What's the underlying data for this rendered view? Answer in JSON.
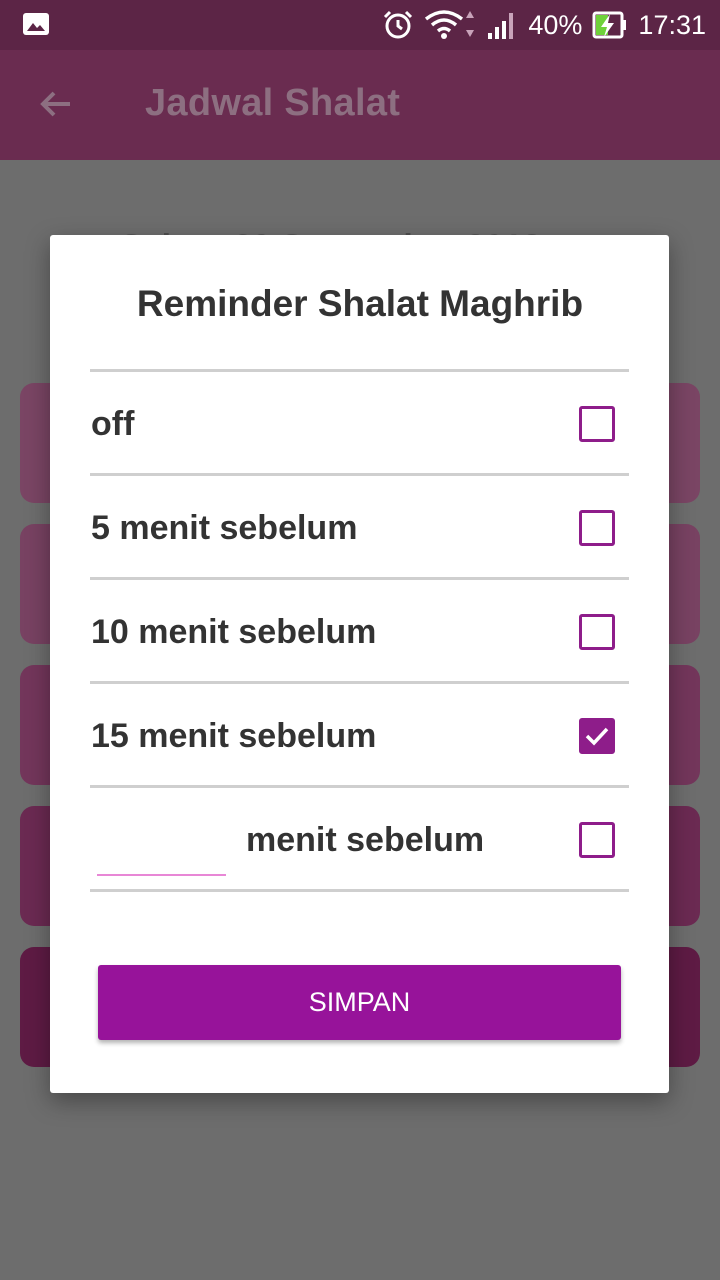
{
  "status_bar": {
    "battery": "40%",
    "time": "17:31"
  },
  "app_bar": {
    "title": "Jadwal Shalat"
  },
  "background": {
    "date_text": "Sabtu, 29 September 2018",
    "card_colors": [
      "#7a4564",
      "#784262",
      "#73365b",
      "#6b2a52",
      "#5e1b44"
    ]
  },
  "dialog": {
    "title": "Reminder Shalat Maghrib",
    "options": [
      {
        "label": "off",
        "checked": false
      },
      {
        "label": "5 menit sebelum",
        "checked": false
      },
      {
        "label": "10 menit sebelum",
        "checked": false
      },
      {
        "label": "15 menit sebelum",
        "checked": true
      }
    ],
    "custom_option": {
      "input_value": "",
      "label": "menit sebelum",
      "checked": false
    },
    "save_button": "SIMPAN"
  },
  "colors": {
    "accent": "#97139a",
    "appbar": "#6a2c50",
    "statusbar": "#5c2546"
  }
}
